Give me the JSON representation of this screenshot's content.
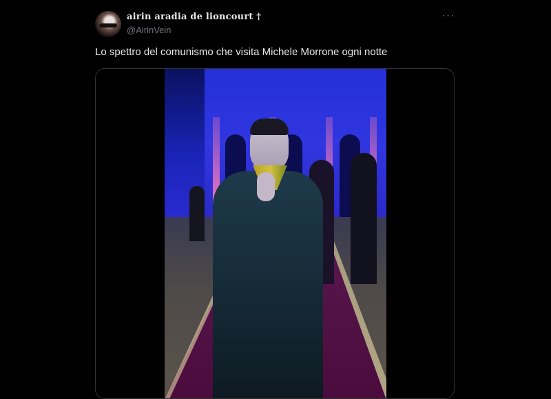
{
  "tweet": {
    "display_name": "airin aradia de lioncourt †",
    "handle": "@AirinVein",
    "text": "Lo spettro del comunismo che visita Michele Morrone ogni notte",
    "more_label": "···",
    "media_type": "video"
  },
  "icons": {
    "more": "more-horizontal-icon"
  },
  "colors": {
    "background": "#000000",
    "text_primary": "#e7e9ea",
    "text_secondary": "#71767b",
    "border": "#2f3336"
  }
}
